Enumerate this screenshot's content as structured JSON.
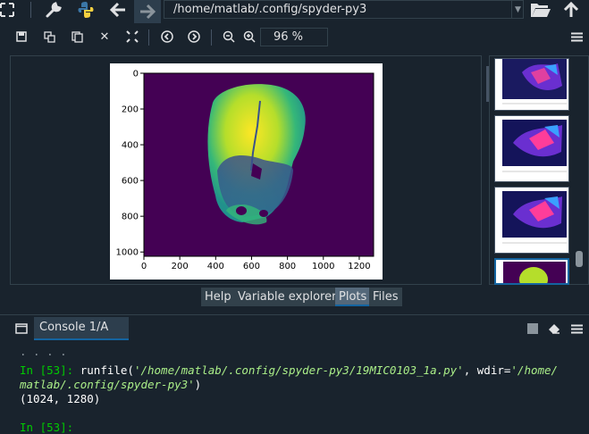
{
  "toolbar": {
    "path": "/home/matlab/.config/spyder-py3"
  },
  "plots_toolbar": {
    "zoom": "96 %"
  },
  "figure": {
    "x_ticks": [
      "0",
      "200",
      "400",
      "600",
      "800",
      "1000",
      "1200"
    ],
    "y_ticks": [
      "0",
      "200",
      "400",
      "600",
      "800",
      "1000"
    ]
  },
  "pane_tabs": [
    {
      "label": "Help"
    },
    {
      "label": "Variable explorer"
    },
    {
      "label": "Plots"
    },
    {
      "label": "Files"
    }
  ],
  "console_tab": {
    "label": "Console 1/A"
  },
  "console": {
    "prompt1": "In [53]:",
    "cmd_start": " runfile(",
    "cmd_arg1": "'/home/matlab/.config/spyder-py3/19MIC0103_1a.py'",
    "cmd_mid": ", wdir=",
    "cmd_arg2a": "'/home/",
    "cmd_arg2b": "matlab/.config/spyder-py3'",
    "cmd_end": ")",
    "output": "(1024, 1280)",
    "prompt2": "In [53]:"
  },
  "colors": {
    "background": "#19232d",
    "accent": "#1464a0",
    "plot_purple": "#440154",
    "plot_yellow": "#fde725"
  }
}
